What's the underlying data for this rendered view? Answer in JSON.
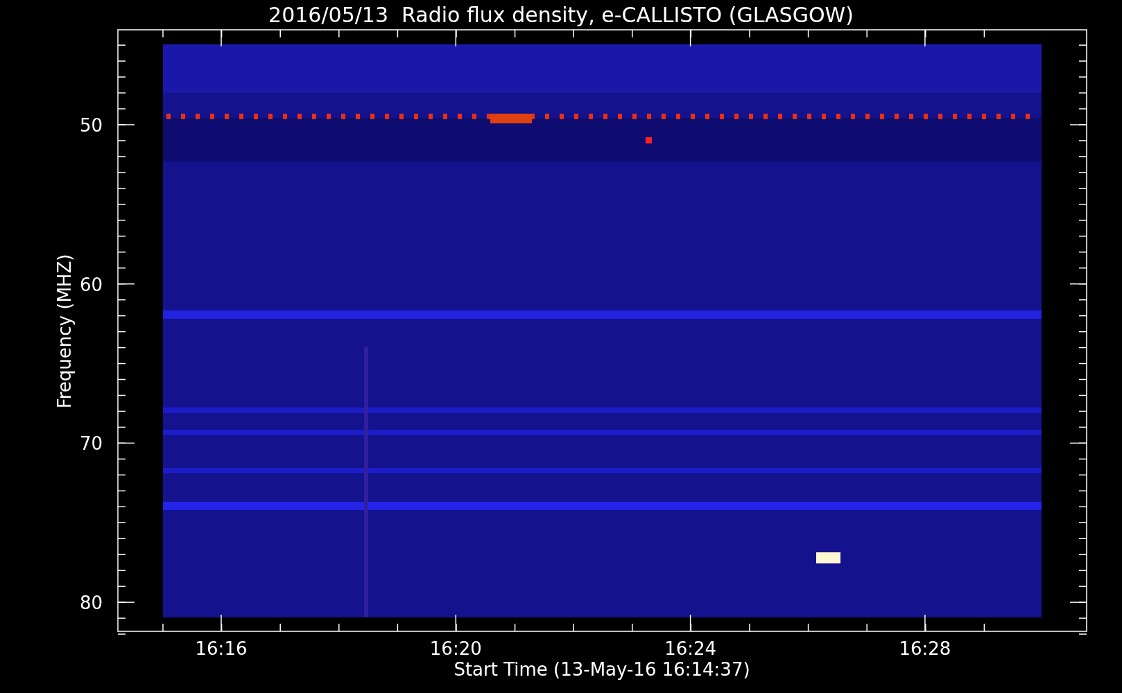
{
  "title": "2016/05/13  Radio flux density, e-CALLISTO (GLASGOW)",
  "y_axis": {
    "label": "Frequency (MHZ)",
    "ticks": [
      "50",
      "60",
      "70",
      "80"
    ]
  },
  "x_axis": {
    "label": "Start Time (13-May-16 16:14:37)",
    "ticks": [
      "16:16",
      "16:20",
      "16:24",
      "16:28"
    ]
  }
}
